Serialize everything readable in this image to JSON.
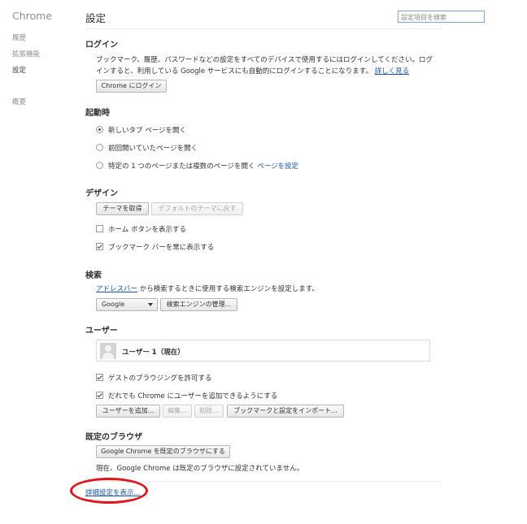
{
  "sidebar": {
    "brand": "Chrome",
    "items": [
      {
        "label": "履歴"
      },
      {
        "label": "拡張機能"
      },
      {
        "label": "設定"
      },
      {
        "label": "概要"
      }
    ]
  },
  "header": {
    "title": "設定",
    "search_placeholder": "設定項目を検索"
  },
  "login": {
    "title": "ログイン",
    "desc_line1": "ブックマーク、履歴、パスワードなどの設定をすべてのデバイスで使用するにはログインしてください。ログ",
    "desc_line2": "インすると、利用している Google サービスにも自動的にログインすることになります。",
    "learn_more": "詳しく見る",
    "button": "Chrome にログイン"
  },
  "startup": {
    "title": "起動時",
    "options": [
      {
        "label": "新しいタブ ページを開く",
        "selected": true
      },
      {
        "label": "前回開いていたページを開く",
        "selected": false
      },
      {
        "label": "特定の 1 つのページまたは複数のページを開く",
        "selected": false
      }
    ],
    "set_pages_link": "ページを設定"
  },
  "design": {
    "title": "デザイン",
    "get_themes": "テーマを取得",
    "reset_theme": "デフォルトのテーマに戻す",
    "show_home_button": {
      "label": "ホーム ボタンを表示する",
      "checked": false
    },
    "show_bookmarks_bar": {
      "label": "ブックマーク バーを常に表示する",
      "checked": true
    }
  },
  "search": {
    "title": "検索",
    "omnibox_link": "アドレスバー",
    "desc": " から検索するときに使用する検索エンジンを設定します。",
    "engine_selected": "Google",
    "manage_button": "検索エンジンの管理..."
  },
  "users": {
    "title": "ユーザー",
    "current_user": "ユーザー 1（現在）",
    "guest_browsing": {
      "label": "ゲストのブラウジングを許可する",
      "checked": true
    },
    "anyone_add": {
      "label": "だれでも Chrome にユーザーを追加できるようにする",
      "checked": true
    },
    "add_user": "ユーザーを追加...",
    "edit": "編集...",
    "delete": "削除...",
    "import": "ブックマークと設定をインポート..."
  },
  "default_browser": {
    "title": "既定のブラウザ",
    "button": "Google Chrome を既定のブラウザにする",
    "status": "現在、Google Chrome は既定のブラウザに設定されていません。"
  },
  "advanced": {
    "link": "詳細設定を表示..."
  },
  "colors": {
    "link": "#1a55b0",
    "highlight": "#e0141b"
  }
}
